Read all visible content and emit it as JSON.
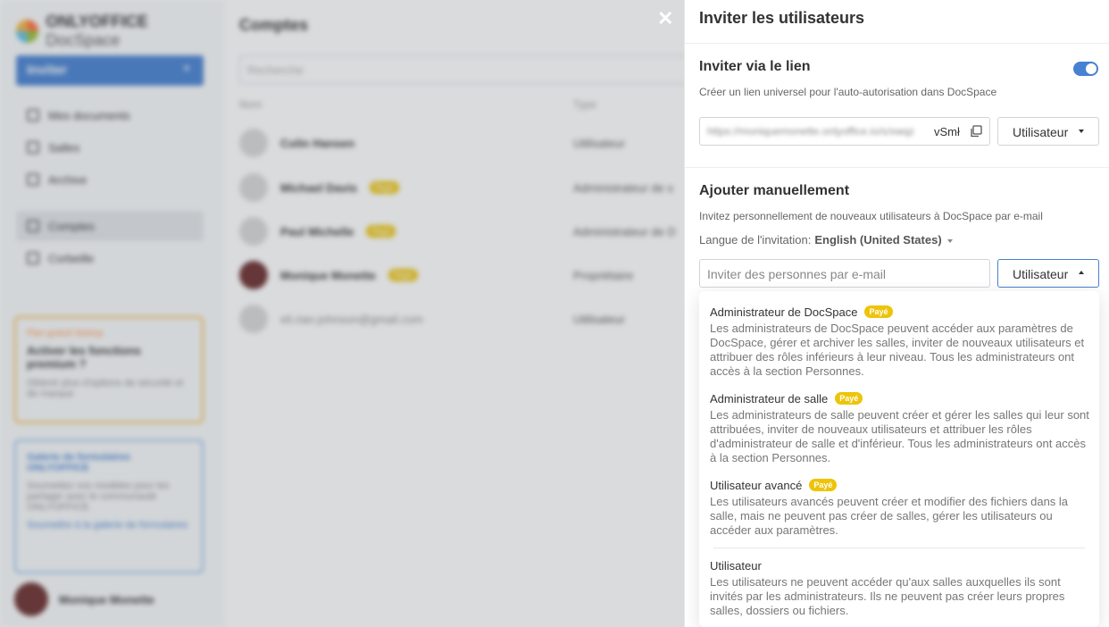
{
  "background": {
    "logo": {
      "brand": "ONLYOFFICE",
      "product": "DocSpace"
    },
    "invite_button": "Inviter",
    "nav": [
      {
        "label": "Mes documents",
        "icon": "document-icon"
      },
      {
        "label": "Salles",
        "icon": "rooms-icon"
      },
      {
        "label": "Archive",
        "icon": "archive-icon"
      },
      {
        "label": "Comptes",
        "icon": "accounts-icon",
        "active": true
      },
      {
        "label": "Corbeille",
        "icon": "trash-icon"
      }
    ],
    "promo": {
      "tag": "Plan gratuit Startup",
      "title": "Activer les fonctions premium ?",
      "text": "Obtenir plus d'options de sécurité et de marque"
    },
    "gallery": {
      "title": "Galerie de formulaires ONLYOFFICE",
      "text": "Soumettez vos modèles pour les partager avec le communauté ONLYOFFICE.",
      "link": "Soumettre à la galerie de formulaires"
    },
    "profile_name": "Monique Monette",
    "page_title": "Comptes",
    "search_placeholder": "Recherche",
    "col_name": "Nom",
    "col_type": "Type",
    "rows": [
      {
        "name": "Colin Hansen",
        "type": "Utilisateur"
      },
      {
        "name": "Michael Davis",
        "badge": "Payé",
        "type": "Administrateur de s"
      },
      {
        "name": "Paul Michelle",
        "badge": "Payé",
        "type": "Administrateur de D"
      },
      {
        "name": "Monique Monette",
        "badge": "Payé",
        "type": "Propriétaire"
      },
      {
        "name": "eli.rian.johnson@gmail.com",
        "type": "Utilisateur"
      }
    ]
  },
  "panel": {
    "title": "Inviter les utilisateurs",
    "link_section": {
      "title": "Inviter via le lien",
      "subtitle": "Créer un lien universel pour l'auto-autorisation dans DocSpace",
      "toggle_on": true,
      "url_blurred": "https://moniquemonette.onlyoffice.io/s/xwqz",
      "url_tail": "vSmł",
      "role": "Utilisateur"
    },
    "manual_section": {
      "title": "Ajouter manuellement",
      "subtitle": "Invitez personnellement de nouveaux utilisateurs à DocSpace par e-mail",
      "language_label": "Langue de l'invitation:",
      "language_value": "English (United States)",
      "email_placeholder": "Inviter des personnes par e-mail",
      "role": "Utilisateur"
    },
    "role_options": [
      {
        "title": "Administrateur de DocSpace",
        "badge": "Payé",
        "description": "Les administrateurs de DocSpace peuvent accéder aux paramètres de DocSpace, gérer et archiver les salles, inviter de nouveaux utilisateurs et attribuer des rôles inférieurs à leur niveau. Tous les administrateurs ont accès à la section Personnes."
      },
      {
        "title": "Administrateur de salle",
        "badge": "Payé",
        "description": "Les administrateurs de salle peuvent créer et gérer les salles qui leur sont attribuées, inviter de nouveaux utilisateurs et attribuer les rôles d'administrateur de salle et d'inférieur. Tous les administrateurs ont accès à la section Personnes."
      },
      {
        "title": "Utilisateur avancé",
        "badge": "Payé",
        "description": "Les utilisateurs avancés peuvent créer et modifier des fichiers dans la salle, mais ne peuvent pas créer de salles, gérer les utilisateurs ou accéder aux paramètres."
      },
      {
        "title": "Utilisateur",
        "badge": "",
        "description": "Les utilisateurs ne peuvent accéder qu'aux salles auxquelles ils sont invités par les administrateurs. Ils ne peuvent pas créer leurs propres salles, dossiers ou fichiers."
      }
    ]
  }
}
